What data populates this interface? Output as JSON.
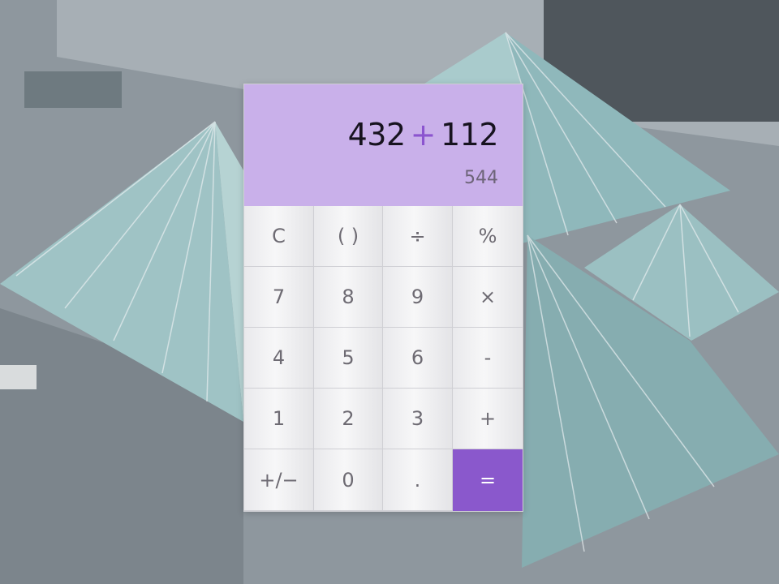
{
  "display": {
    "left_operand": "432",
    "operator": "+",
    "right_operand": "112",
    "result": "544"
  },
  "keypad": [
    {
      "label": "C",
      "name": "clear-key"
    },
    {
      "label": "( )",
      "name": "parentheses-key"
    },
    {
      "label": "÷",
      "name": "divide-key"
    },
    {
      "label": "%",
      "name": "percent-key"
    },
    {
      "label": "7",
      "name": "digit-7-key"
    },
    {
      "label": "8",
      "name": "digit-8-key"
    },
    {
      "label": "9",
      "name": "digit-9-key"
    },
    {
      "label": "×",
      "name": "multiply-key"
    },
    {
      "label": "4",
      "name": "digit-4-key"
    },
    {
      "label": "5",
      "name": "digit-5-key"
    },
    {
      "label": "6",
      "name": "digit-6-key"
    },
    {
      "label": "-",
      "name": "subtract-key"
    },
    {
      "label": "1",
      "name": "digit-1-key"
    },
    {
      "label": "2",
      "name": "digit-2-key"
    },
    {
      "label": "3",
      "name": "digit-3-key"
    },
    {
      "label": "+",
      "name": "add-key"
    },
    {
      "label": "+∕−",
      "name": "sign-toggle-key"
    },
    {
      "label": "0",
      "name": "digit-0-key"
    },
    {
      "label": ".",
      "name": "decimal-key"
    },
    {
      "label": "=",
      "name": "equals-key"
    }
  ],
  "colors": {
    "display_bg": "#c9b0ea",
    "accent": "#8a58cc",
    "operator_text": "#8b54cf",
    "key_text": "#6e6b73"
  }
}
